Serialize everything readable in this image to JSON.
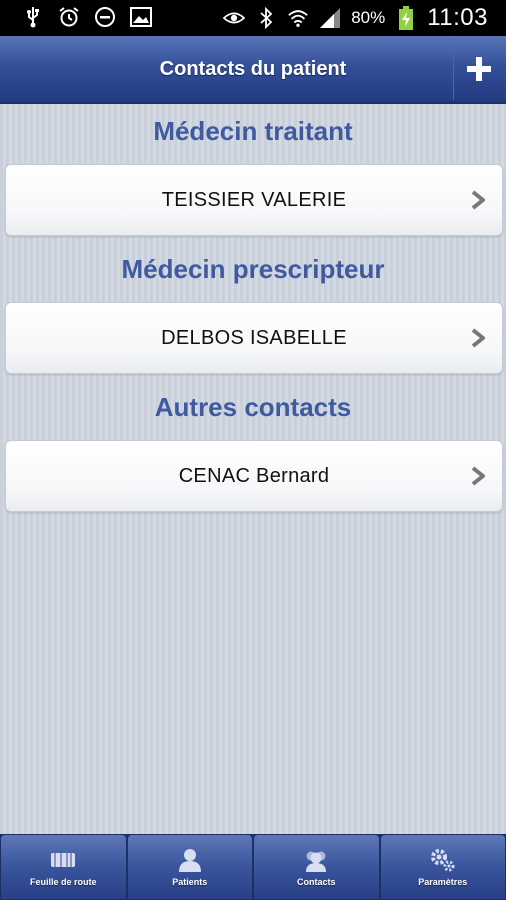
{
  "status_bar": {
    "left_icons": [
      "usb-icon",
      "alarm-icon",
      "do-not-disturb-icon",
      "image-icon"
    ],
    "right_icons": [
      "eye-icon",
      "bluetooth-icon",
      "wifi-icon",
      "signal-icon"
    ],
    "battery_percent": "80%",
    "time": "11:03"
  },
  "action_bar": {
    "title": "Contacts du patient",
    "add_icon": "plus-icon"
  },
  "sections": [
    {
      "title": "Médecin traitant",
      "contact": "TEISSIER VALERIE"
    },
    {
      "title": "Médecin prescripteur",
      "contact": "DELBOS ISABELLE"
    },
    {
      "title": "Autres contacts",
      "contact": "CENAC Bernard"
    }
  ],
  "tabs": [
    {
      "label": "Feuille de route",
      "icon": "route-sheet-icon"
    },
    {
      "label": "Patients",
      "icon": "patient-icon"
    },
    {
      "label": "Contacts",
      "icon": "contacts-icon"
    },
    {
      "label": "Paramètres",
      "icon": "settings-gear-icon"
    }
  ],
  "colors": {
    "accent": "#3f5aa0",
    "action_bar": "#34509a",
    "status_bar": "#000000"
  }
}
